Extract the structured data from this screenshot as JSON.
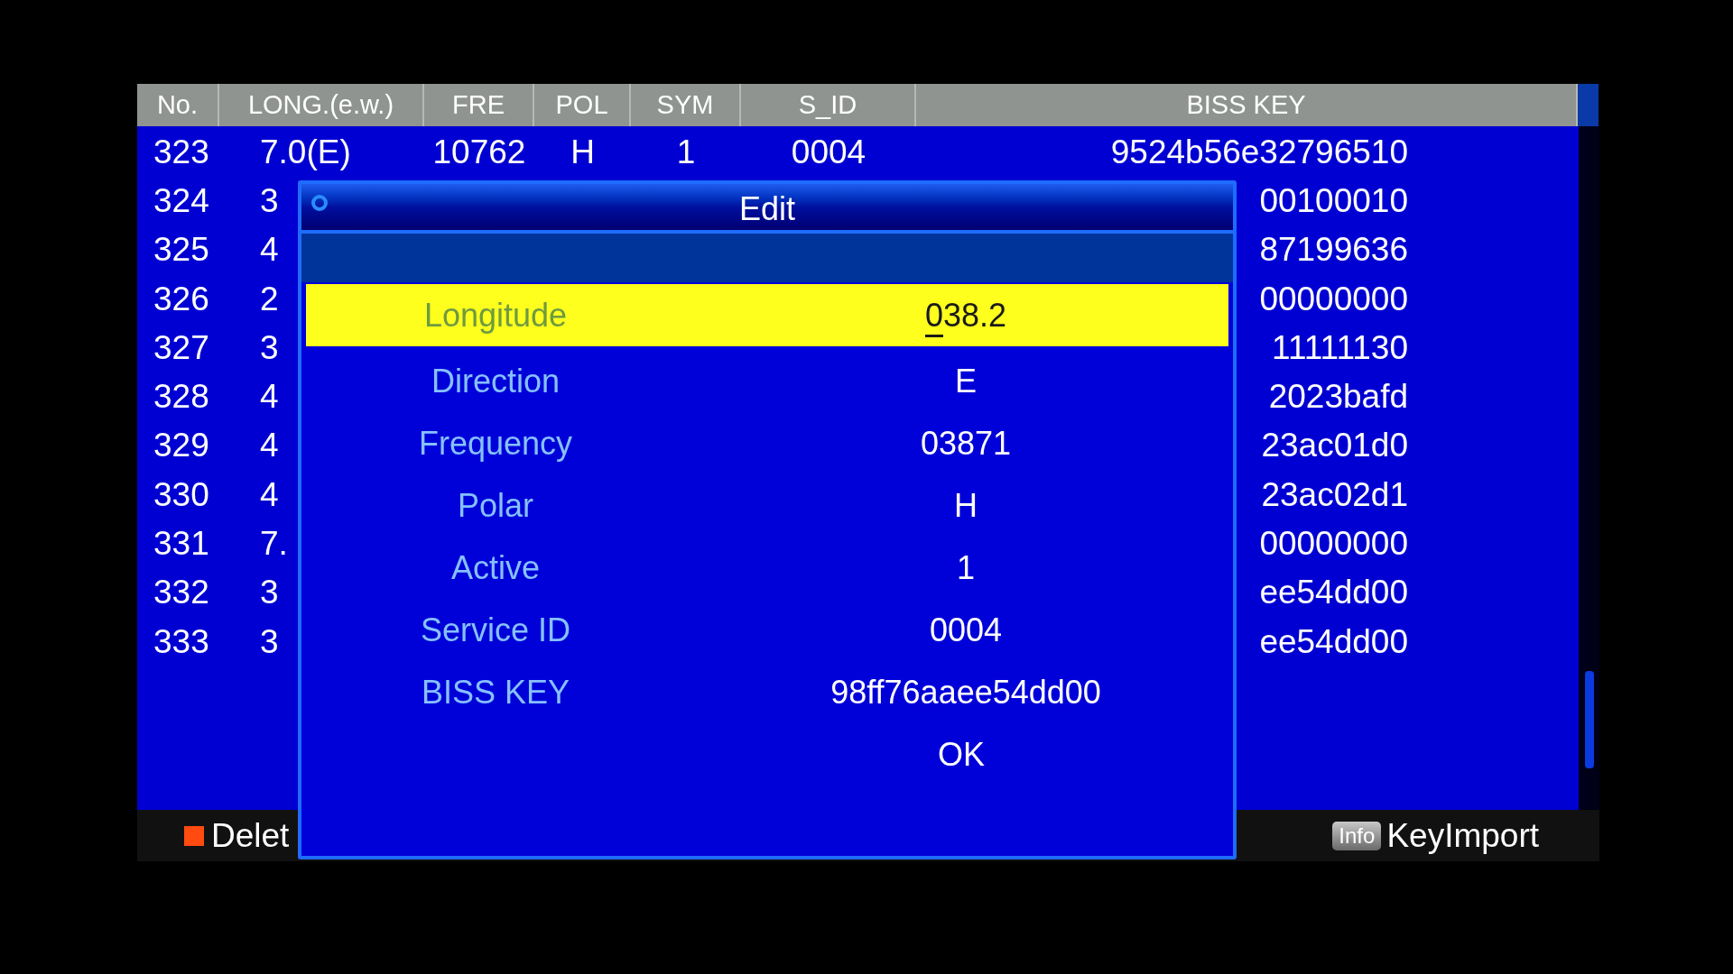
{
  "table": {
    "columns": [
      "No.",
      "LONG.(e.w.)",
      "FRE",
      "POL",
      "SYM",
      "S_ID",
      "BISS KEY"
    ],
    "rows": [
      {
        "no": "323",
        "long": "7.0(E)",
        "fre": "10762",
        "pol": "H",
        "sym": "1",
        "s_id": "0004",
        "biss_key": "9524b56e32796510"
      },
      {
        "no": "324",
        "long": "3",
        "biss_key": "00100010"
      },
      {
        "no": "325",
        "long": "4",
        "biss_key": "87199636"
      },
      {
        "no": "326",
        "long": "2",
        "biss_key": "00000000"
      },
      {
        "no": "327",
        "long": "3",
        "biss_key": "11111130"
      },
      {
        "no": "328",
        "long": "4",
        "biss_key": "2023bafd"
      },
      {
        "no": "329",
        "long": "4",
        "biss_key": "23ac01d0"
      },
      {
        "no": "330",
        "long": "4",
        "biss_key": "23ac02d1"
      },
      {
        "no": "331",
        "long": "7.",
        "biss_key": "00000000"
      },
      {
        "no": "332",
        "long": "3",
        "biss_key": "ee54dd00"
      },
      {
        "no": "333",
        "long": "3",
        "biss_key": "ee54dd00"
      }
    ]
  },
  "footer": [
    {
      "kind": "red",
      "label": "Delet"
    },
    {
      "kind": "info",
      "badge": "Info",
      "label": "KeyImport"
    }
  ],
  "dialog": {
    "title": "Edit",
    "fields": [
      {
        "label": "Longitude",
        "value": "038.2",
        "selected": true
      },
      {
        "label": "Direction",
        "value": "E",
        "selected": false
      },
      {
        "label": "Frequency",
        "value": "03871",
        "selected": false
      },
      {
        "label": "Polar",
        "value": "H",
        "selected": false
      },
      {
        "label": "Active",
        "value": "1",
        "selected": false
      },
      {
        "label": "Service ID",
        "value": "0004",
        "selected": false
      },
      {
        "label": "BISS KEY",
        "value": "98ff76aaee54dd00",
        "selected": false
      }
    ],
    "ok_button": "OK"
  }
}
